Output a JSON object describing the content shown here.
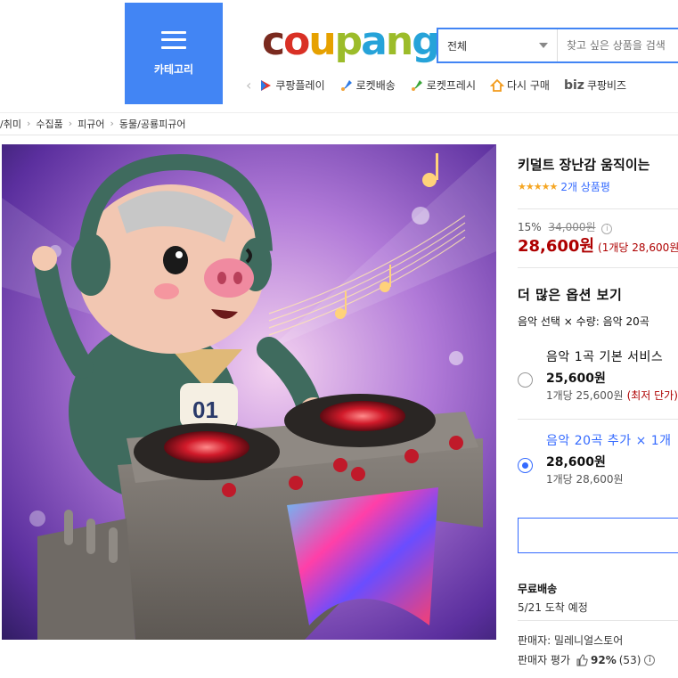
{
  "header": {
    "category_label": "카테고리",
    "logo": [
      "c",
      "o",
      "u",
      "p",
      "a",
      "n",
      "g"
    ],
    "search": {
      "scope_selected": "전체",
      "placeholder": "찾고 싶은 상품을 검색"
    },
    "subnav": [
      {
        "icon": "play-icon",
        "label": "쿠팡플레이"
      },
      {
        "icon": "rocket-delivery-icon",
        "label": "로켓배송"
      },
      {
        "icon": "rocket-fresh-icon",
        "label": "로켓프레시"
      },
      {
        "icon": "house-icon",
        "label": "다시 구매"
      },
      {
        "icon": "biz-icon",
        "prefix": "biz",
        "label": "쿠팡비즈"
      }
    ]
  },
  "breadcrumb": [
    "/취미",
    "수집품",
    "피규어",
    "동물/공룡피규어"
  ],
  "product": {
    "title": "키덜트 장난감 움직이는",
    "rating_stars": "★★★★★",
    "review_count": "2개 상품평",
    "discount_rate": "15%",
    "original_price": "34,000원",
    "sale_price": "28,600원",
    "unit_price": "(1개당 28,600원)",
    "image_badge_text": "01"
  },
  "options": {
    "header": "더 많은 옵션 보기",
    "summary": "음악 선택 × 수량: 음악 20곡",
    "items": [
      {
        "name": "음악 1곡 기본 서비스",
        "price": "25,600원",
        "unit": "1개당 25,600원",
        "note": "(최저 단가)",
        "selected": false
      },
      {
        "name": "음악 20곡 추가 × 1개",
        "price": "28,600원",
        "unit": "1개당 28,600원",
        "note": "",
        "selected": true
      }
    ]
  },
  "shipping": {
    "label": "무료배송",
    "arrival": "5/21 도착 예정"
  },
  "seller": {
    "name": "판매자: 밀레니얼스토어",
    "rating_label": "판매자 평가",
    "rating_pct": "92%",
    "rating_count": "(53)"
  },
  "colors": {
    "accent_blue": "#346aff",
    "category_blue": "#4285f4",
    "price_red": "#ae0000",
    "star_orange": "#f5a623"
  }
}
